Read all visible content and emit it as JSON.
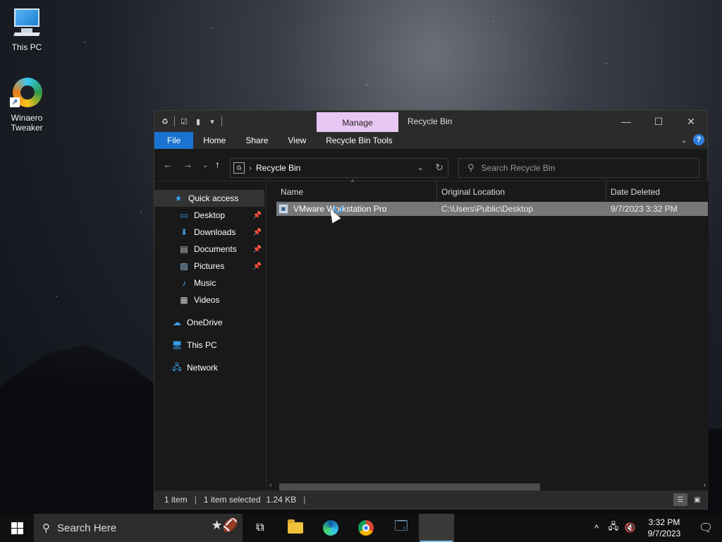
{
  "desktop": {
    "icons": [
      {
        "label": "This PC"
      },
      {
        "label": "Winaero\nTweaker"
      }
    ]
  },
  "window": {
    "title": "Recycle Bin",
    "context_tab": "Manage",
    "ribbon_tabs": {
      "file": "File",
      "home": "Home",
      "share": "Share",
      "view": "View",
      "tools": "Recycle Bin Tools"
    },
    "address": {
      "crumb": "Recycle Bin"
    },
    "search": {
      "placeholder": "Search Recycle Bin"
    },
    "nav_pane": {
      "quick_access": "Quick access",
      "items": [
        {
          "label": "Desktop",
          "pinned": true
        },
        {
          "label": "Downloads",
          "pinned": true
        },
        {
          "label": "Documents",
          "pinned": true
        },
        {
          "label": "Pictures",
          "pinned": true
        },
        {
          "label": "Music",
          "pinned": false
        },
        {
          "label": "Videos",
          "pinned": false
        }
      ],
      "onedrive": "OneDrive",
      "this_pc": "This PC",
      "network": "Network"
    },
    "columns": {
      "name": "Name",
      "original_location": "Original Location",
      "date_deleted": "Date Deleted"
    },
    "rows": [
      {
        "name": "VMware Workstation Pro",
        "original_location": "C:\\Users\\Public\\Desktop",
        "date_deleted": "9/7/2023 3:32 PM"
      }
    ],
    "status": {
      "count": "1 item",
      "selected": "1 item selected",
      "size": "1.24 KB"
    }
  },
  "taskbar": {
    "search_placeholder": "Search Here",
    "clock_time": "3:32 PM",
    "clock_date": "9/7/2023"
  },
  "colors": {
    "accent": "#1a73d0",
    "manage_tab": "#e8c7f2",
    "selection": "#777777"
  }
}
